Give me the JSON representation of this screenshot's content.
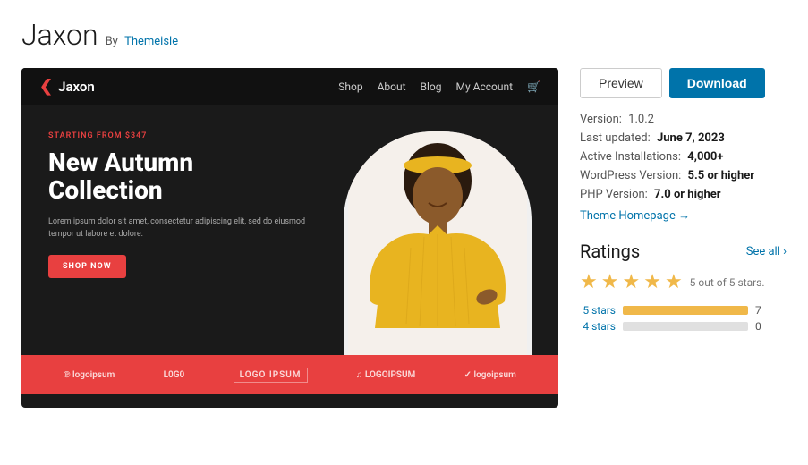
{
  "header": {
    "title": "Jaxon",
    "author_prefix": "By",
    "author_name": "Themeisle",
    "author_url": "#"
  },
  "mock_theme": {
    "logo_icon": "❮",
    "logo_text": "Jaxon",
    "nav_links": [
      "Shop",
      "About",
      "Blog",
      "My Account"
    ],
    "hero_subtitle": "Starting from $347",
    "hero_title": "New Autumn Collection",
    "hero_desc": "Lorem ipsum dolor sit amet, consectetur adipiscing elit, sed do eiusmod tempor ut labore et dolore.",
    "hero_btn": "Shop Now",
    "logos": [
      "logoipsum",
      "L0GO",
      "LOGO IPSUM",
      "LOGOIPSUM",
      "logoipsum"
    ]
  },
  "actions": {
    "preview_label": "Preview",
    "download_label": "Download"
  },
  "meta": {
    "version_label": "Version:",
    "version_value": "1.0.2",
    "updated_label": "Last updated:",
    "updated_value": "June 7, 2023",
    "installs_label": "Active Installations:",
    "installs_value": "4,000+",
    "wp_label": "WordPress Version:",
    "wp_value": "5.5 or higher",
    "php_label": "PHP Version:",
    "php_value": "7.0 or higher",
    "homepage_label": "Theme Homepage →"
  },
  "ratings": {
    "title": "Ratings",
    "see_all": "See all ›",
    "stars_out_of": "5 out of 5 stars.",
    "bars": [
      {
        "label": "5 stars",
        "fill_pct": 100,
        "count": 7
      },
      {
        "label": "4 stars",
        "fill_pct": 0,
        "count": 0
      }
    ]
  }
}
